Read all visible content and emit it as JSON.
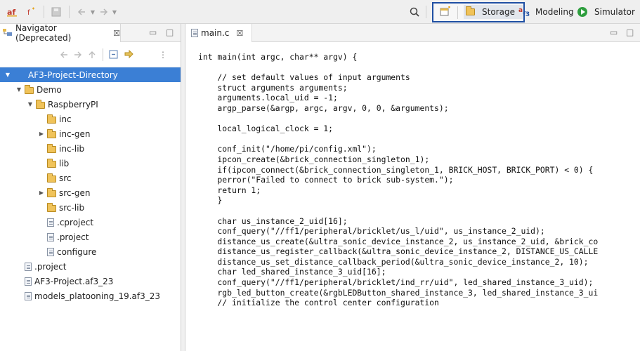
{
  "toolbar": {
    "left_icons": [
      "af3-logo-icon",
      "new-element-icon",
      "save-icon",
      "back-icon",
      "back-dropdown-icon",
      "forward-icon",
      "forward-dropdown-icon"
    ],
    "search_icon": "search-icon",
    "perspectives": [
      {
        "label": "",
        "icon": "open-perspective-icon"
      },
      {
        "label": "Storage",
        "icon": "folder-icon"
      },
      {
        "label": "Modeling",
        "icon": "af3-modeling-icon"
      },
      {
        "label": "Simulator",
        "icon": "play-icon"
      }
    ]
  },
  "navigator": {
    "tab_label": "Navigator (Deprecated)",
    "close_glyph": "☒",
    "tree": [
      {
        "label": "AF3-Project-Directory",
        "depth": 0,
        "type": "project",
        "expanded": true,
        "selected": true
      },
      {
        "label": "Demo",
        "depth": 1,
        "type": "folder",
        "expanded": true
      },
      {
        "label": "RaspberryPI",
        "depth": 2,
        "type": "folder",
        "expanded": true
      },
      {
        "label": "inc",
        "depth": 3,
        "type": "folder"
      },
      {
        "label": "inc-gen",
        "depth": 3,
        "type": "folder",
        "collapsed": true
      },
      {
        "label": "inc-lib",
        "depth": 3,
        "type": "folder"
      },
      {
        "label": "lib",
        "depth": 3,
        "type": "folder"
      },
      {
        "label": "src",
        "depth": 3,
        "type": "folder"
      },
      {
        "label": "src-gen",
        "depth": 3,
        "type": "folder",
        "collapsed": true
      },
      {
        "label": "src-lib",
        "depth": 3,
        "type": "folder"
      },
      {
        "label": ".cproject",
        "depth": 3,
        "type": "file"
      },
      {
        "label": ".project",
        "depth": 3,
        "type": "file"
      },
      {
        "label": "configure",
        "depth": 3,
        "type": "file"
      },
      {
        "label": ".project",
        "depth": 1,
        "type": "file"
      },
      {
        "label": "AF3-Project.af3_23",
        "depth": 1,
        "type": "file"
      },
      {
        "label": "models_platooning_19.af3_23",
        "depth": 1,
        "type": "file"
      }
    ]
  },
  "editor": {
    "tab_label": "main.c",
    "close_glyph": "☒",
    "code_lines": [
      "int main(int argc, char** argv) {",
      "",
      "    // set default values of input arguments",
      "    struct arguments arguments;",
      "    arguments.local_uid = -1;",
      "    argp_parse(&argp, argc, argv, 0, 0, &arguments);",
      "",
      "    local_logical_clock = 1;",
      "",
      "    conf_init(\"/home/pi/config.xml\");",
      "    ipcon_create(&brick_connection_singleton_1);",
      "    if(ipcon_connect(&brick_connection_singleton_1, BRICK_HOST, BRICK_PORT) < 0) {",
      "    perror(\"Failed to connect to brick sub-system.\");",
      "    return 1;",
      "    }",
      "",
      "    char us_instance_2_uid[16];",
      "    conf_query(\"//ff1/peripheral/bricklet/us_l/uid\", us_instance_2_uid);",
      "    distance_us_create(&ultra_sonic_device_instance_2, us_instance_2_uid, &brick_co",
      "    distance_us_register_callback(&ultra_sonic_device_instance_2, DISTANCE_US_CALLE",
      "    distance_us_set_distance_callback_period(&ultra_sonic_device_instance_2, 10);",
      "    char led_shared_instance_3_uid[16];",
      "    conf_query(\"//ff1/peripheral/bricklet/ind_rr/uid\", led_shared_instance_3_uid);",
      "    rgb_led_button_create(&rgbLEDButton_shared_instance_3, led_shared_instance_3_ui",
      "    // initialize the control center configuration"
    ]
  },
  "colors": {
    "selection": "#3b7fd5",
    "perspective_highlight": "#1f4fa3",
    "folder": "#f0c35a",
    "simulator_play": "#2e9e3e"
  }
}
